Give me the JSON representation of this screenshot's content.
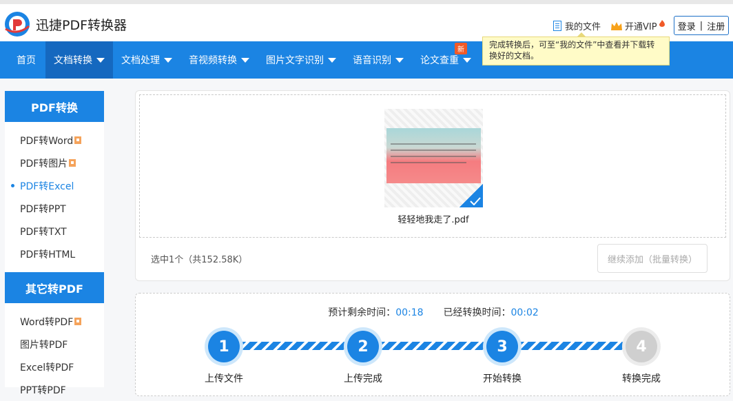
{
  "header": {
    "brand": "迅捷PDF转换器",
    "my_files": "我的文件",
    "vip": "开通VIP",
    "login": "登录",
    "sep": "|",
    "register": "注册"
  },
  "nav": {
    "items": [
      "首页",
      "文档转换",
      "文档处理",
      "音视频转换",
      "图片文字识别",
      "语音识别",
      "论文查重"
    ],
    "new_badge": "新"
  },
  "tooltip": "完成转换后，可至“我的文件”中查看并下载转换好的文档。",
  "sidebar": {
    "section1": "PDF转换",
    "items1": [
      "PDF转Word",
      "PDF转图片",
      "PDF转Excel",
      "PDF转PPT",
      "PDF转TXT",
      "PDF转HTML"
    ],
    "section2": "其它转PDF",
    "items2": [
      "Word转PDF",
      "图片转PDF",
      "Excel转PDF",
      "PPT转PDF"
    ]
  },
  "upload": {
    "filename": "轻轻地我走了.pdf",
    "selection": "选中1个（共152.58K）",
    "add_button": "继续添加（批量转换）"
  },
  "progress": {
    "remaining_label": "预计剩余时间：",
    "remaining": "00:18",
    "elapsed_label": "已经转换时间：",
    "elapsed": "00:02",
    "steps": [
      {
        "num": "1",
        "label": "上传文件"
      },
      {
        "num": "2",
        "label": "上传完成"
      },
      {
        "num": "3",
        "label": "开始转换"
      },
      {
        "num": "4",
        "label": "转换完成"
      }
    ]
  },
  "colors": {
    "accent": "#1b84e3",
    "nav_active": "#1568bf",
    "tooltip_bg": "#fffbc7"
  }
}
